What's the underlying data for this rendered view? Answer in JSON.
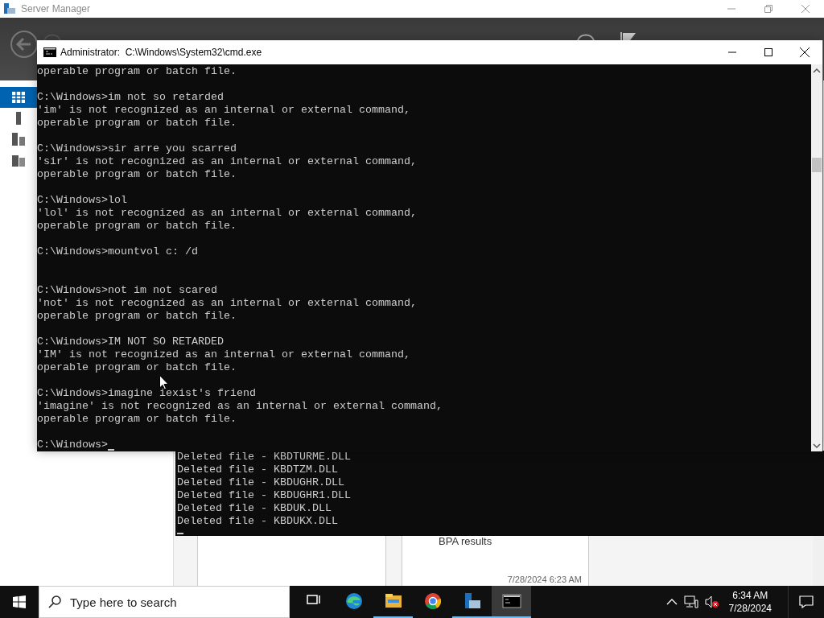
{
  "server_manager": {
    "title": "Server Manager",
    "sidebar": {
      "items": [
        {
          "kind": "dashboard",
          "selected": true
        },
        {
          "kind": "server",
          "selected": false
        },
        {
          "kind": "servers",
          "selected": false
        },
        {
          "kind": "roles",
          "selected": false
        }
      ]
    },
    "tiles": [
      {
        "title": "BPA results",
        "time": "7/28/2024 6:23 AM"
      }
    ]
  },
  "background_console": {
    "lines": [
      "Deleted file - KBDTURME.DLL",
      "Deleted file - KBDTZM.DLL",
      "Deleted file - KBDUGHR.DLL",
      "Deleted file - KBDUGHR1.DLL",
      "Deleted file - KBDUK.DLL",
      "Deleted file - KBDUKX.DLL"
    ]
  },
  "cmd_window": {
    "title": "Administrator:  C:\\Windows\\System32\\cmd.exe",
    "lines": [
      {
        "kind": "text",
        "text": "operable program or batch file."
      },
      {
        "kind": "blank"
      },
      {
        "kind": "text",
        "text": "C:\\Windows>im not so retarded"
      },
      {
        "kind": "text",
        "text": "'im' is not recognized as an internal or external command,"
      },
      {
        "kind": "text",
        "text": "operable program or batch file."
      },
      {
        "kind": "blank"
      },
      {
        "kind": "text",
        "text": "C:\\Windows>sir arre you scarred"
      },
      {
        "kind": "text",
        "text": "'sir' is not recognized as an internal or external command,"
      },
      {
        "kind": "text",
        "text": "operable program or batch file."
      },
      {
        "kind": "blank"
      },
      {
        "kind": "text",
        "text": "C:\\Windows>lol"
      },
      {
        "kind": "text",
        "text": "'lol' is not recognized as an internal or external command,"
      },
      {
        "kind": "text",
        "text": "operable program or batch file."
      },
      {
        "kind": "blank"
      },
      {
        "kind": "text",
        "text": "C:\\Windows>mountvol c: /d"
      },
      {
        "kind": "blank"
      },
      {
        "kind": "blank"
      },
      {
        "kind": "text",
        "text": "C:\\Windows>not im not scared"
      },
      {
        "kind": "text",
        "text": "'not' is not recognized as an internal or external command,"
      },
      {
        "kind": "text",
        "text": "operable program or batch file."
      },
      {
        "kind": "blank"
      },
      {
        "kind": "text",
        "text": "C:\\Windows>IM NOT SO RETARDED"
      },
      {
        "kind": "text",
        "text": "'IM' is not recognized as an internal or external command,"
      },
      {
        "kind": "text",
        "text": "operable program or batch file."
      },
      {
        "kind": "blank"
      },
      {
        "kind": "text",
        "text": "C:\\Windows>imagine iexist's friend"
      },
      {
        "kind": "text",
        "text": "'imagine' is not recognized as an internal or external command,"
      },
      {
        "kind": "text",
        "text": "operable program or batch file."
      },
      {
        "kind": "blank"
      },
      {
        "kind": "prompt",
        "text": "C:\\Windows>"
      }
    ]
  },
  "taskbar": {
    "search": {
      "placeholder": "Type here to search"
    },
    "apps": [
      {
        "kind": "task-view",
        "running": false,
        "selected": false
      },
      {
        "kind": "edge",
        "running": false,
        "selected": false
      },
      {
        "kind": "explorer",
        "running": true,
        "selected": false
      },
      {
        "kind": "chrome",
        "running": false,
        "selected": false
      },
      {
        "kind": "server-manager",
        "running": true,
        "selected": false
      },
      {
        "kind": "cmd",
        "running": true,
        "selected": true
      }
    ],
    "clock": {
      "time": "6:34 AM",
      "date": "7/28/2024"
    }
  }
}
